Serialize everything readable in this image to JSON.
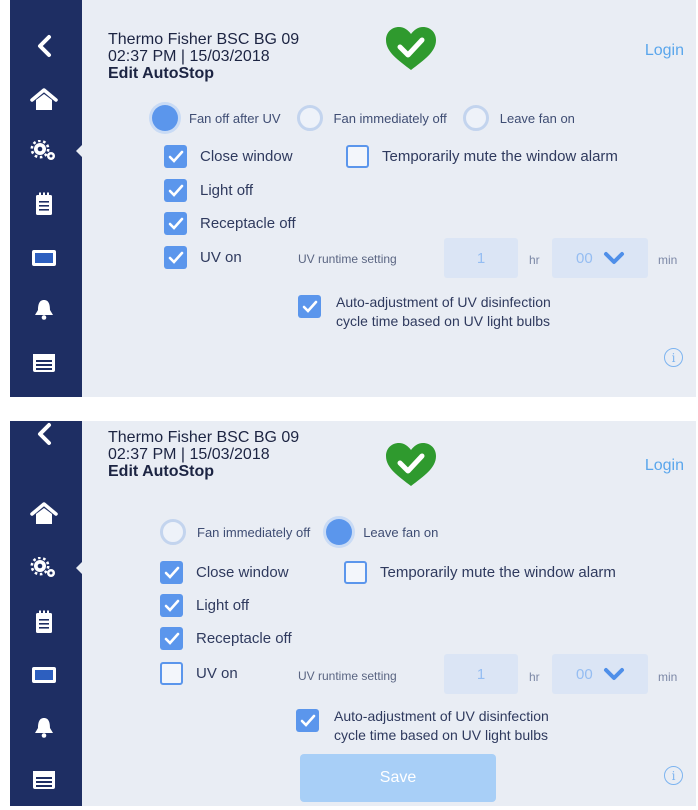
{
  "device_name": "Thermo Fisher BSC BG 09",
  "datetime": "02:37 PM | 15/03/2018",
  "page_title": "Edit AutoStop",
  "login_label": "Login",
  "sidebar_icons": [
    "back-arrow-icon",
    "home-icon",
    "gears-icon",
    "notepad-icon",
    "screen-icon",
    "bell-icon",
    "calendar-icon"
  ],
  "screen1": {
    "fan_options": [
      {
        "label": "Fan off after UV",
        "selected": true
      },
      {
        "label": "Fan immediately off",
        "selected": false
      },
      {
        "label": "Leave fan on",
        "selected": false
      }
    ],
    "checkboxes": [
      {
        "label": "Close window",
        "checked": true
      },
      {
        "label": "Temporarily mute the window alarm",
        "checked": false
      },
      {
        "label": "Light off",
        "checked": true
      },
      {
        "label": "Receptacle off",
        "checked": true
      },
      {
        "label": "UV on",
        "checked": true
      }
    ],
    "uv_runtime_label": "UV runtime setting",
    "uv_hours": "1",
    "hr_unit": "hr",
    "uv_minutes": "00",
    "min_unit": "min",
    "auto_adjust_line1": "Auto-adjustment of UV disinfection",
    "auto_adjust_line2": "cycle time based on UV light bulbs",
    "auto_adjust_checked": true
  },
  "screen2": {
    "fan_options": [
      {
        "label": "Fan immediately off",
        "selected": false
      },
      {
        "label": "Leave fan on",
        "selected": true
      }
    ],
    "checkboxes": [
      {
        "label": "Close window",
        "checked": true
      },
      {
        "label": "Temporarily mute the window alarm",
        "checked": false
      },
      {
        "label": "Light off",
        "checked": true
      },
      {
        "label": "Receptacle off",
        "checked": true
      },
      {
        "label": "UV on",
        "checked": false
      }
    ],
    "uv_runtime_label": "UV runtime setting",
    "uv_hours": "1",
    "hr_unit": "hr",
    "uv_minutes": "00",
    "min_unit": "min",
    "auto_adjust_line1": "Auto-adjustment of UV disinfection",
    "auto_adjust_line2": "cycle time based on UV light bulbs",
    "auto_adjust_checked": true,
    "save_label": "Save"
  },
  "colors": {
    "sidebar": "#1e2e63",
    "accent": "#5b96ec",
    "heart": "#2f9a2e",
    "login": "#5aa6ec"
  }
}
